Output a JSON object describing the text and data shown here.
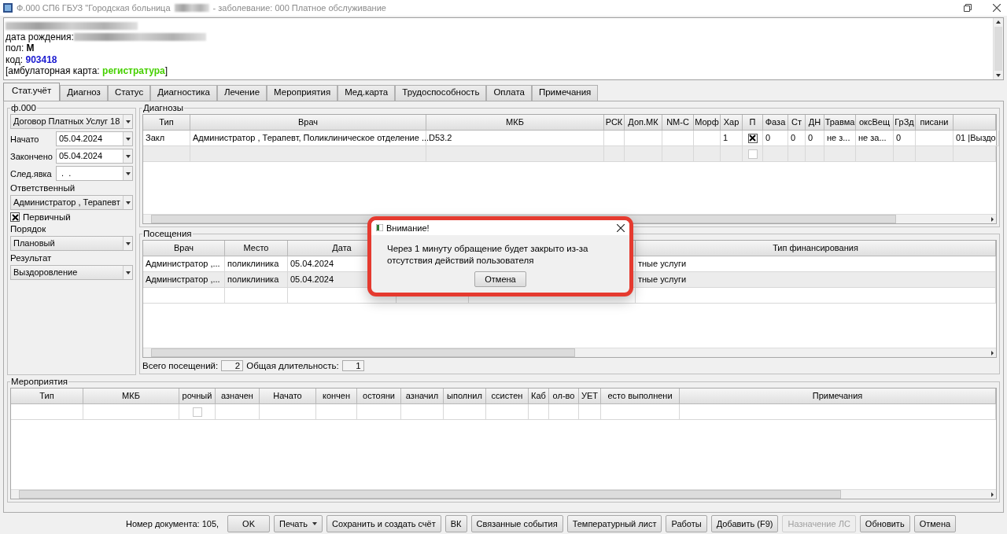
{
  "window": {
    "title_start": "Ф.000 СП6 ГБУЗ \"Городская больница",
    "title_end": "- заболевание: 000 Платное обслуживание"
  },
  "patient": {
    "birth_label": "дата рождения:",
    "sex_label": "пол:",
    "sex": "М",
    "code_label": "код:",
    "code": "903418",
    "card_label": "[амбулаторная карта:",
    "card": "регистратура",
    "card_end": "]"
  },
  "tabs": [
    {
      "label": "Стат.учёт",
      "selected": true
    },
    {
      "label": "Диагноз",
      "selected": false
    },
    {
      "label": "Статус",
      "selected": false
    },
    {
      "label": "Диагностика",
      "selected": false
    },
    {
      "label": "Лечение",
      "selected": false
    },
    {
      "label": "Мероприятия",
      "selected": false
    },
    {
      "label": "Мед.карта",
      "selected": false
    },
    {
      "label": "Трудоспособность",
      "selected": false
    },
    {
      "label": "Оплата",
      "selected": false
    },
    {
      "label": "Примечания",
      "selected": false
    }
  ],
  "left": {
    "group": "ф.000",
    "contract": "Договор Платных Услуг 18",
    "started_label": "Начато",
    "started": "05.04.2024",
    "ended_label": "Закончено",
    "ended": "05.04.2024",
    "next_label": "След.явка",
    "next": " .  .",
    "responsible_label": "Ответственный",
    "responsible": "Администратор , Терапевт",
    "primary_label": "Первичный",
    "primary_checked": true,
    "order_label": "Порядок",
    "order": "Плановый",
    "result_label": "Результат",
    "result": "Выздоровление"
  },
  "diagnoses": {
    "title": "Диагнозы",
    "columns": [
      {
        "label": "Тип",
        "kind": "text"
      },
      {
        "label": "Врач",
        "kind": "text"
      },
      {
        "label": "МКБ",
        "kind": "text"
      },
      {
        "label": "РСК",
        "kind": "text"
      },
      {
        "label": "Доп.МК",
        "kind": "text"
      },
      {
        "label": "NM-С",
        "kind": "text"
      },
      {
        "label": "Морф",
        "kind": "text"
      },
      {
        "label": "Хар",
        "kind": "text"
      },
      {
        "label": "П",
        "kind": "check"
      },
      {
        "label": "Фаза",
        "kind": "text"
      },
      {
        "label": "Ст",
        "kind": "text"
      },
      {
        "label": "ДН",
        "kind": "text"
      },
      {
        "label": "Травма",
        "kind": "text"
      },
      {
        "label": "оксВещ",
        "kind": "text"
      },
      {
        "label": "ГрЗд",
        "kind": "text"
      },
      {
        "label": "писани",
        "kind": "text"
      },
      {
        "kind": "text"
      }
    ],
    "rows": [
      {
        "cells": [
          {
            "text": "Закл"
          },
          {
            "text": "Администратор , Терапевт, Поликлиническое отделение ..."
          },
          {
            "text": "D53.2"
          },
          {},
          {},
          {},
          {},
          {
            "text": "1"
          },
          {
            "checked": true
          },
          {
            "text": "0"
          },
          {
            "text": "0"
          },
          {
            "text": "0"
          },
          {
            "text": "не з..."
          },
          {
            "text": "не за..."
          },
          {
            "text": "0"
          },
          {},
          {
            "text": "01 |Выздо"
          }
        ]
      },
      {
        "cells": [
          {},
          {},
          {},
          {},
          {},
          {},
          {},
          {},
          {
            "checked": false
          },
          {},
          {},
          {},
          {},
          {},
          {},
          {},
          {}
        ]
      }
    ]
  },
  "visits": {
    "title": "Посещения",
    "columns": [
      {
        "label": "Врач"
      },
      {
        "label": "Место"
      },
      {
        "label": "Дата"
      },
      {},
      {},
      {
        "label": "Тип финансирования"
      }
    ],
    "rows": [
      {
        "cells": [
          {
            "text": "Администратор ,..."
          },
          {
            "text": "поликлиника"
          },
          {
            "text": "05.04.2024"
          },
          {},
          {},
          {
            "text": "тные услуги"
          }
        ]
      },
      {
        "cells": [
          {
            "text": "Администратор ,..."
          },
          {
            "text": "поликлиника"
          },
          {
            "text": "05.04.2024"
          },
          {},
          {},
          {
            "text": "тные услуги"
          }
        ]
      }
    ],
    "total_label": "Всего посещений:",
    "total": "2",
    "duration_label": "Общая длительность:",
    "duration": "1"
  },
  "events": {
    "title": "Мероприятия",
    "columns": [
      {
        "label": "Тип",
        "kind": "text"
      },
      {
        "label": "МКБ",
        "kind": "text"
      },
      {
        "label": "рочный",
        "kind": "check"
      },
      {
        "label": "азначен",
        "kind": "text"
      },
      {
        "label": "Начато",
        "kind": "text"
      },
      {
        "label": "кончен",
        "kind": "text"
      },
      {
        "label": "остояни",
        "kind": "text"
      },
      {
        "label": "азначил",
        "kind": "text"
      },
      {
        "label": "ыполнил",
        "kind": "text"
      },
      {
        "label": "ссистен",
        "kind": "text"
      },
      {
        "label": "Каб",
        "kind": "text"
      },
      {
        "label": "ол-во",
        "kind": "text"
      },
      {
        "label": "УЕТ",
        "kind": "text"
      },
      {
        "label": "есто выполнени",
        "kind": "text"
      },
      {
        "label": "Примечания",
        "kind": "text"
      }
    ],
    "rows": [
      {
        "cells": [
          {},
          {},
          {
            "checked": false
          },
          {},
          {},
          {},
          {},
          {},
          {},
          {},
          {},
          {},
          {},
          {},
          {}
        ]
      }
    ]
  },
  "status_bar": {
    "doc_number": "Номер документа: 105,"
  },
  "buttons": [
    {
      "label": "OK",
      "kind": "plain",
      "disabled": false
    },
    {
      "label": "Печать",
      "kind": "menu",
      "disabled": false
    },
    {
      "label": "Сохранить и создать счёт",
      "kind": "plain",
      "disabled": false
    },
    {
      "label": "ВК",
      "kind": "plain",
      "disabled": false
    },
    {
      "label": "Связанные события",
      "kind": "plain",
      "disabled": false
    },
    {
      "label": "Температурный лист",
      "kind": "plain",
      "disabled": false
    },
    {
      "label": "Работы",
      "kind": "plain",
      "disabled": false
    },
    {
      "label": "Добавить (F9)",
      "kind": "plain",
      "disabled": false
    },
    {
      "label": "Назначение ЛС",
      "kind": "plain",
      "disabled": true
    },
    {
      "label": "Обновить",
      "kind": "plain",
      "disabled": false
    },
    {
      "label": "Отмена",
      "kind": "plain",
      "disabled": false
    }
  ],
  "dialog": {
    "title": "Внимание!",
    "message": "Через 1 минуту обращение будет закрыто из-за отсутствия действий пользователя",
    "button": "Отмена"
  }
}
